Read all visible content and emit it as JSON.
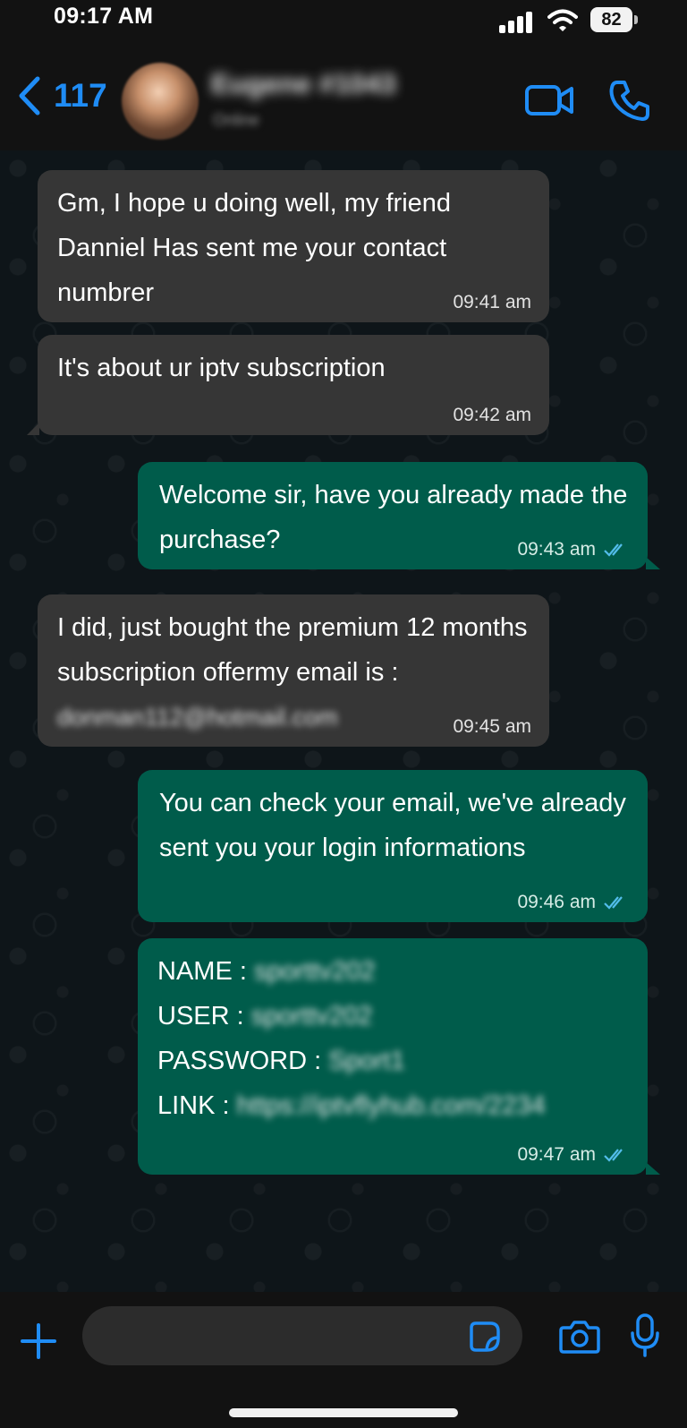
{
  "status_bar": {
    "time": "09:17 AM",
    "battery": "82"
  },
  "header": {
    "back_count": "117",
    "contact_name": "Eugene #1043",
    "contact_status": "Online"
  },
  "messages": [
    {
      "direction": "incoming",
      "text": "Gm, I hope u doing well, my friend Danniel Has sent me your contact numbrer",
      "time": "09:41 am"
    },
    {
      "direction": "incoming",
      "text": "It's about ur iptv subscription",
      "time": "09:42 am"
    },
    {
      "direction": "outgoing",
      "text": "Welcome sir, have you already made the purchase?",
      "time": "09:43 am",
      "read": true
    },
    {
      "direction": "incoming",
      "text": "I did, just bought the premium 12 months subscription offermy email is :",
      "email": "donman112@hotmail.com",
      "time": "09:45 am"
    },
    {
      "direction": "outgoing",
      "text": "You can check your email, we've already sent you your login informations",
      "time": "09:46 am",
      "read": true
    },
    {
      "direction": "outgoing",
      "fields": [
        {
          "label": "NAME :",
          "value": "sporttv202"
        },
        {
          "label": "USER :",
          "value": "sporttv202"
        },
        {
          "label": "PASSWORD :",
          "value": "Sport1"
        },
        {
          "label": "LINK :",
          "value": "https://iptvflyhub.com/2234"
        }
      ],
      "time": "09:47 am",
      "read": true
    }
  ],
  "input": {
    "placeholder": ""
  },
  "colors": {
    "accent": "#1f8cf5",
    "incoming_bubble": "#363636",
    "outgoing_bubble": "#005c4b",
    "background": "#0b141a"
  },
  "icons": [
    "back-chevron-icon",
    "video-call-icon",
    "phone-icon",
    "plus-icon",
    "sticker-icon",
    "camera-icon",
    "microphone-icon",
    "double-check-icon"
  ]
}
